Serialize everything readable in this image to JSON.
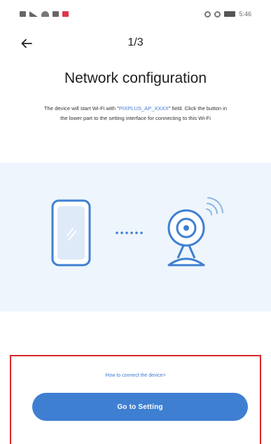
{
  "status_bar": {
    "time": "5:46",
    "left_icons": [
      "sim-icon",
      "signal-icon",
      "wifi-icon",
      "message-icon",
      "notification-icon"
    ],
    "right_icons": [
      "alarm-icon",
      "vibrate-icon",
      "battery-icon"
    ]
  },
  "nav": {
    "back_icon": "arrow-left-icon",
    "step": "1/3"
  },
  "page": {
    "title": "Network configuration",
    "description_prefix": "The device will start Wi-Fi with \"",
    "description_highlight": "PIXPLUS_AP_XXXX",
    "description_suffix": "\" field. Click the button in the lower part to the setting interface for connecting to this Wi-Fi"
  },
  "illustration": {
    "icons": [
      "phone-icon",
      "connecting-dots-icon",
      "camera-icon",
      "wifi-signal-icon"
    ]
  },
  "actions": {
    "help_link": "How to connect the device>",
    "primary_button": "Go to Setting"
  },
  "colors": {
    "accent": "#3f7fd2",
    "highlight_text": "#3f7ad6",
    "illustration_bg": "#eef5fc",
    "annotation_border": "#d9262c"
  }
}
